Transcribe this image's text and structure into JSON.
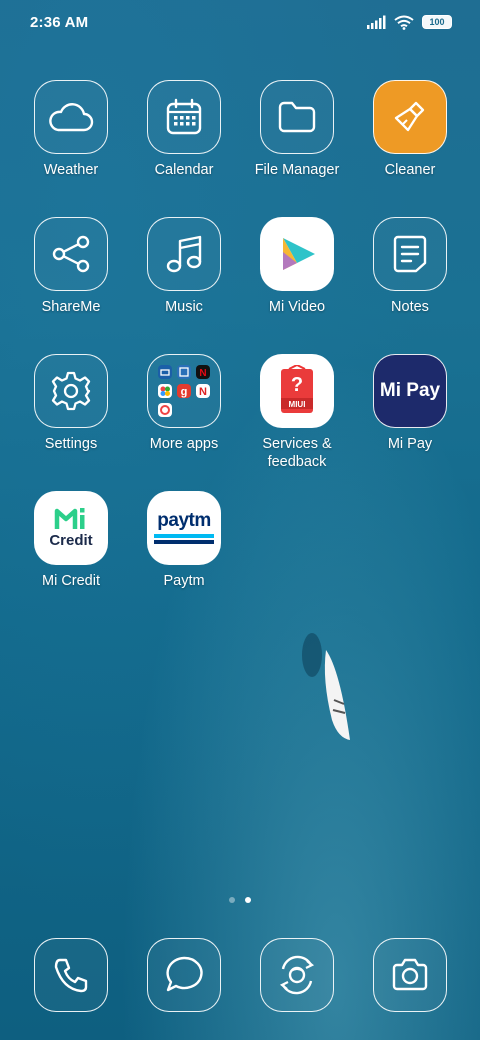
{
  "status_bar": {
    "time": "2:36 AM",
    "battery": "100"
  },
  "apps": [
    {
      "label": "Weather",
      "icon": "weather-cloud-icon"
    },
    {
      "label": "Calendar",
      "icon": "calendar-icon"
    },
    {
      "label": "File Manager",
      "icon": "folder-icon"
    },
    {
      "label": "Cleaner",
      "icon": "broom-icon"
    },
    {
      "label": "ShareMe",
      "icon": "share-icon"
    },
    {
      "label": "Music",
      "icon": "music-note-icon"
    },
    {
      "label": "Mi Video",
      "icon": "play-icon"
    },
    {
      "label": "Notes",
      "icon": "notes-icon"
    },
    {
      "label": "Settings",
      "icon": "gear-icon"
    },
    {
      "label": "More apps",
      "icon": "folder-apps-icon"
    },
    {
      "label": "Services &",
      "label2": "feedback",
      "icon": "services-feedback-icon",
      "icon_text": "MIUI"
    },
    {
      "label": "Mi Pay",
      "icon": "mi-pay-icon",
      "icon_text": "Mi Pay"
    },
    {
      "label": "Mi Credit",
      "icon": "mi-credit-icon",
      "icon_text": "Credit"
    },
    {
      "label": "Paytm",
      "icon": "paytm-icon",
      "icon_text": "paytm"
    }
  ],
  "dock": [
    {
      "name": "phone-icon"
    },
    {
      "name": "messages-icon"
    },
    {
      "name": "browser-icon"
    },
    {
      "name": "camera-icon"
    }
  ],
  "colors": {
    "cleaner": "#ee9a25",
    "mi_pay": "#1d2a6b",
    "paytm_blue": "#002e6e",
    "paytm_cyan": "#00baf2",
    "mi_credit_green": "#2ccf8a"
  }
}
